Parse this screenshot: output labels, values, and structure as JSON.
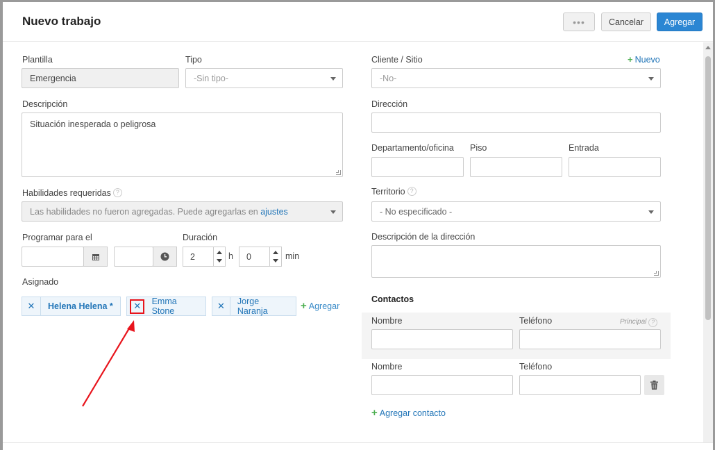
{
  "header": {
    "title": "Nuevo trabajo",
    "more_label": "•••",
    "cancel_label": "Cancelar",
    "add_label": "Agregar"
  },
  "left": {
    "template_label": "Plantilla",
    "template_value": "Emergencia",
    "type_label": "Tipo",
    "type_value": "-Sin tipo-",
    "description_label": "Descripción",
    "description_value": "Situación inesperada o peligrosa",
    "skills_label": "Habilidades requeridas",
    "skills_text": "Las habilidades no fueron agregadas. Puede agregarlas en",
    "skills_link": "ajustes",
    "schedule_label": "Programar para el",
    "duration_label": "Duración",
    "hours_value": "2",
    "hours_unit": "h",
    "minutes_value": "0",
    "minutes_unit": "min",
    "assigned_label": "Asignado",
    "assignees": [
      {
        "name": "Helena Helena *"
      },
      {
        "name": "Emma Stone"
      },
      {
        "name": "Jorge Naranja"
      }
    ],
    "add_assignee_label": "Agregar"
  },
  "right": {
    "client_label": "Cliente / Sitio",
    "new_client_label": "Nuevo",
    "client_value": "-No-",
    "address_label": "Dirección",
    "address_value": "",
    "apartment_label": "Departamento/oficina",
    "floor_label": "Piso",
    "entrance_label": "Entrada",
    "territory_label": "Territorio",
    "territory_value": "- No especificado -",
    "address_desc_label": "Descripción de la dirección",
    "contacts_title": "Contactos",
    "contacts": [
      {
        "name_label": "Nombre",
        "phone_label": "Teléfono",
        "principal_label": "Principal"
      },
      {
        "name_label": "Nombre",
        "phone_label": "Teléfono"
      }
    ],
    "add_contact_label": "Agregar contacto"
  },
  "colors": {
    "primary": "#2b86d3",
    "link": "#2376b8",
    "add_green": "#4caf50",
    "highlight_red": "#e8141c"
  }
}
